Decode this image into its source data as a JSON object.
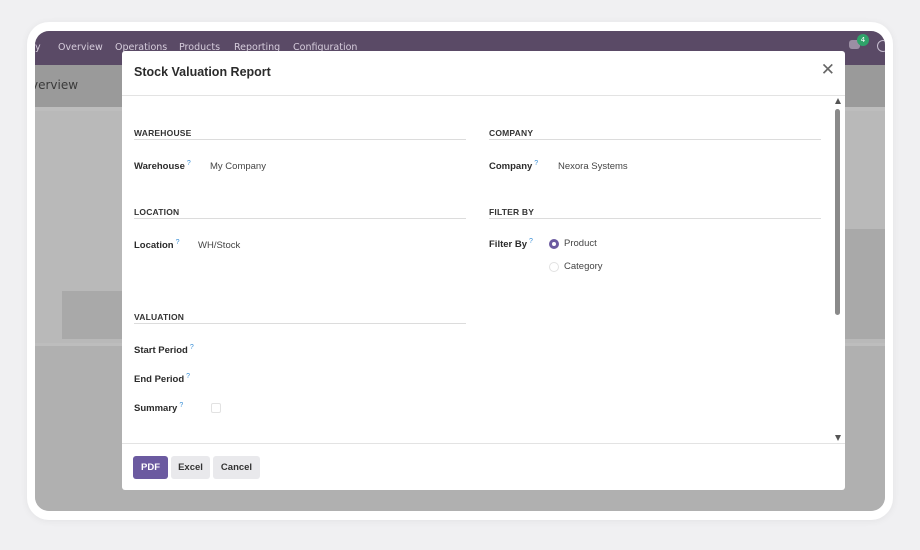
{
  "app": {
    "nav": [
      "y",
      "Overview",
      "Operations",
      "Products",
      "Reporting",
      "Configuration"
    ],
    "breadcrumb": "verview",
    "chat_count": "4"
  },
  "dialog": {
    "title": "Stock Valuation Report",
    "close_icon": "close-icon",
    "sections": {
      "warehouse": "WAREHOUSE",
      "company": "COMPANY",
      "location": "LOCATION",
      "filter_by": "FILTER BY",
      "valuation": "VALUATION"
    },
    "fields": {
      "warehouse": {
        "label": "Warehouse",
        "value": "My Company"
      },
      "company": {
        "label": "Company",
        "value": "Nexora Systems"
      },
      "location": {
        "label": "Location",
        "value": "WH/Stock"
      },
      "filter_by": {
        "label": "Filter By",
        "options": [
          "Product",
          "Category"
        ],
        "selected": "Product"
      },
      "start_period": {
        "label": "Start Period",
        "value": ""
      },
      "end_period": {
        "label": "End Period",
        "value": ""
      },
      "summary": {
        "label": "Summary",
        "checked": false
      }
    },
    "help_marker": "?",
    "buttons": {
      "pdf": "PDF",
      "excel": "Excel",
      "cancel": "Cancel"
    }
  },
  "colors": {
    "primary": "#6b5aa0",
    "topbar": "#5a4a66",
    "help": "#3a8fd6"
  }
}
